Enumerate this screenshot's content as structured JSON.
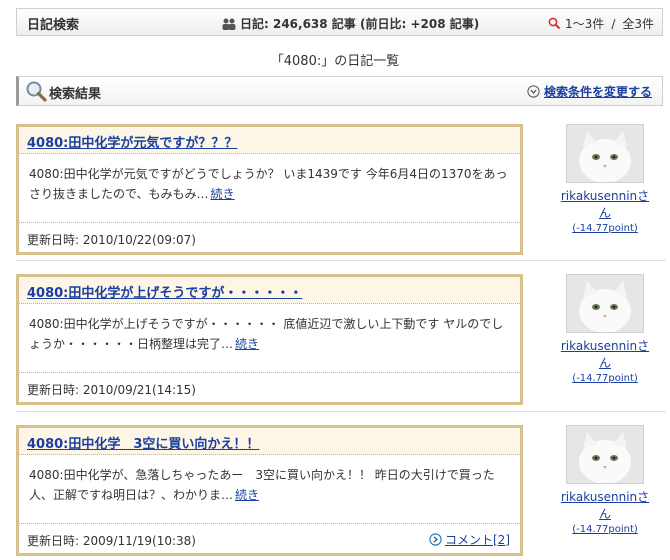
{
  "header": {
    "title": "日記検索",
    "stats": "日記: 246,638 記事 (前日比: +208 記事)",
    "range": "1〜3件",
    "total": "全3件"
  },
  "list_heading": "「4080:」の日記一覧",
  "results": {
    "label": "検索結果",
    "change_link": "検索条件を変更する"
  },
  "entries": [
    {
      "title": "4080:田中化学が元気ですが？？？",
      "excerpt": "4080:田中化学が元気ですがどうでしょうか？ いま1439です 今年6月4日の1370をあっさり抜きましたので、もみもみ…",
      "more": "続き",
      "updated_label": "更新日時:",
      "updated": "2010/10/22(09:07)",
      "author": "rikakusenninさん",
      "points": "(-14.77point)"
    },
    {
      "title": "4080:田中化学が上げそうですが・・・・・・",
      "excerpt": "4080:田中化学が上げそうですが・・・・・・ 底値近辺で激しい上下動です ヤルのでしょうか・・・・・・日柄整理は完了…",
      "more": "続き",
      "updated_label": "更新日時:",
      "updated": "2010/09/21(14:15)",
      "author": "rikakusenninさん",
      "points": "(-14.77point)"
    },
    {
      "title": "4080:田中化学　3空に買い向かえ！！",
      "excerpt": "4080:田中化学が、急落しちゃったあー　3空に買い向かえ！！ 昨日の大引けで買った人、正解ですね明日は？、わかりま…",
      "more": "続き",
      "updated_label": "更新日時:",
      "updated": "2009/11/19(10:38)",
      "comment": "コメント[2]",
      "author": "rikakusenninさん",
      "points": "(-14.77point)"
    }
  ],
  "colors": {
    "link": "#1a3fa0",
    "entry_border": "#d8c08f",
    "entry_head_bg": "#fdf5e6"
  }
}
